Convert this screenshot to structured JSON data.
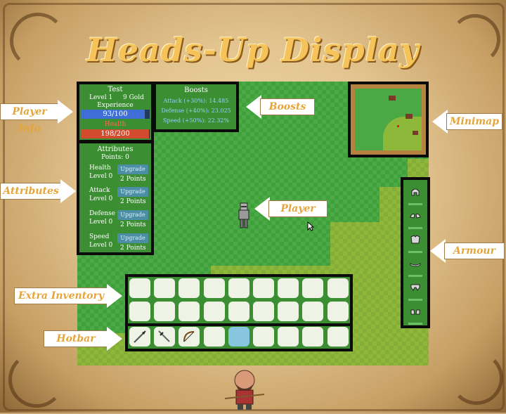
{
  "title": "Heads-Up Display",
  "player_info": {
    "name": "Test",
    "level_text": "Level 1",
    "gold_text": "9 Gold",
    "experience_label": "Experience",
    "experience_value": "93/100",
    "experience_fraction": 0.93,
    "health_label": "Health",
    "health_value": "198/200",
    "health_fraction": 0.99
  },
  "boosts": {
    "title": "Boosts",
    "lines": [
      "Attack (+30%): 14.485",
      "Defense (+40%): 23.025",
      "Speed (+50%): 22.32%"
    ]
  },
  "attributes": {
    "title": "Attributes",
    "points": "Points: 0",
    "items": [
      {
        "name": "Health",
        "level": "Level 0",
        "button": "Upgrade",
        "cost": "2 Points"
      },
      {
        "name": "Attack",
        "level": "Level 0",
        "button": "Upgrade",
        "cost": "2 Points"
      },
      {
        "name": "Defense",
        "level": "Level 0",
        "button": "Upgrade",
        "cost": "2 Points"
      },
      {
        "name": "Speed",
        "level": "Level 0",
        "button": "Upgrade",
        "cost": "2 Points"
      }
    ]
  },
  "callouts": {
    "player_info": "Player Info",
    "boosts": "Boosts",
    "minimap": "Minimap",
    "attributes": "Attributes",
    "player": "Player",
    "armour": "Armour",
    "extra_inventory": "Extra Inventory",
    "hotbar": "Hotbar"
  },
  "inventory": {
    "extra_rows": 2,
    "columns": 9,
    "hotbar": [
      "spear-icon",
      "sword-icon",
      "bow-icon",
      "",
      "",
      "",
      "",
      "",
      ""
    ],
    "hotbar_selected_index": 4
  },
  "armour_slots": [
    "helmet-icon",
    "shoulder-icon",
    "chestplate-icon",
    "belt-icon",
    "leggings-icon",
    "boots-icon"
  ],
  "colors": {
    "title": "#f6c35a",
    "callout_text": "#e4a63a",
    "experience_bar": "#3f6fd6",
    "health_bar": "#d24b2e",
    "grass_dark": "#3fa13a",
    "grass_light": "#8db83a"
  }
}
